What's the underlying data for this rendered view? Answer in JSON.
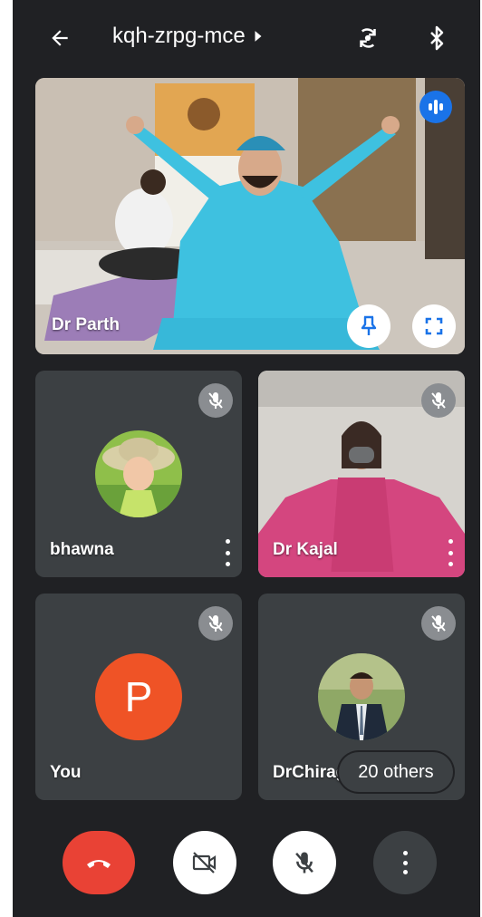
{
  "header": {
    "meeting_code": "kqh-zrpg-mce",
    "back_icon": "arrow-back-icon",
    "rotate_icon": "switch-camera-icon",
    "bt_icon": "bluetooth-icon"
  },
  "participants": [
    {
      "name": "Dr Parth",
      "muted": false,
      "speaking": true
    },
    {
      "name": "bhawna",
      "muted": true
    },
    {
      "name": "Dr Kajal",
      "muted": true
    },
    {
      "name": "You",
      "muted": true,
      "initial": "P"
    },
    {
      "name": "DrChirag",
      "muted": true
    }
  ],
  "others_badge": "20 others",
  "colors": {
    "end_call": "#e94235",
    "avatar_you": "#ef5326",
    "speaking": "#1a73e8",
    "background": "#202124"
  },
  "controls": [
    "end-call",
    "camera-off",
    "mic-off",
    "more-options"
  ]
}
